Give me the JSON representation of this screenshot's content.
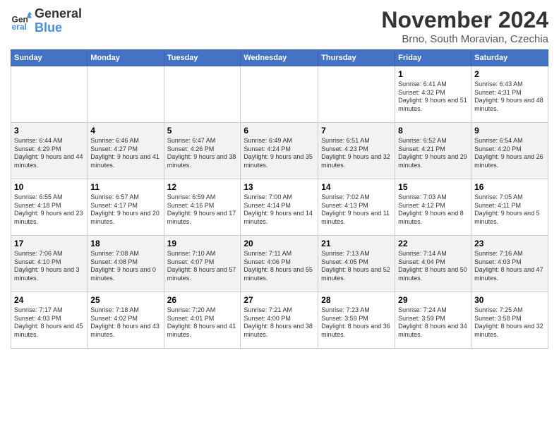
{
  "logo": {
    "line1": "General",
    "line2": "Blue"
  },
  "title": "November 2024",
  "subtitle": "Brno, South Moravian, Czechia",
  "days_of_week": [
    "Sunday",
    "Monday",
    "Tuesday",
    "Wednesday",
    "Thursday",
    "Friday",
    "Saturday"
  ],
  "weeks": [
    [
      {
        "day": "",
        "info": ""
      },
      {
        "day": "",
        "info": ""
      },
      {
        "day": "",
        "info": ""
      },
      {
        "day": "",
        "info": ""
      },
      {
        "day": "",
        "info": ""
      },
      {
        "day": "1",
        "info": "Sunrise: 6:41 AM\nSunset: 4:32 PM\nDaylight: 9 hours and 51 minutes."
      },
      {
        "day": "2",
        "info": "Sunrise: 6:43 AM\nSunset: 4:31 PM\nDaylight: 9 hours and 48 minutes."
      }
    ],
    [
      {
        "day": "3",
        "info": "Sunrise: 6:44 AM\nSunset: 4:29 PM\nDaylight: 9 hours and 44 minutes."
      },
      {
        "day": "4",
        "info": "Sunrise: 6:46 AM\nSunset: 4:27 PM\nDaylight: 9 hours and 41 minutes."
      },
      {
        "day": "5",
        "info": "Sunrise: 6:47 AM\nSunset: 4:26 PM\nDaylight: 9 hours and 38 minutes."
      },
      {
        "day": "6",
        "info": "Sunrise: 6:49 AM\nSunset: 4:24 PM\nDaylight: 9 hours and 35 minutes."
      },
      {
        "day": "7",
        "info": "Sunrise: 6:51 AM\nSunset: 4:23 PM\nDaylight: 9 hours and 32 minutes."
      },
      {
        "day": "8",
        "info": "Sunrise: 6:52 AM\nSunset: 4:21 PM\nDaylight: 9 hours and 29 minutes."
      },
      {
        "day": "9",
        "info": "Sunrise: 6:54 AM\nSunset: 4:20 PM\nDaylight: 9 hours and 26 minutes."
      }
    ],
    [
      {
        "day": "10",
        "info": "Sunrise: 6:55 AM\nSunset: 4:18 PM\nDaylight: 9 hours and 23 minutes."
      },
      {
        "day": "11",
        "info": "Sunrise: 6:57 AM\nSunset: 4:17 PM\nDaylight: 9 hours and 20 minutes."
      },
      {
        "day": "12",
        "info": "Sunrise: 6:59 AM\nSunset: 4:16 PM\nDaylight: 9 hours and 17 minutes."
      },
      {
        "day": "13",
        "info": "Sunrise: 7:00 AM\nSunset: 4:14 PM\nDaylight: 9 hours and 14 minutes."
      },
      {
        "day": "14",
        "info": "Sunrise: 7:02 AM\nSunset: 4:13 PM\nDaylight: 9 hours and 11 minutes."
      },
      {
        "day": "15",
        "info": "Sunrise: 7:03 AM\nSunset: 4:12 PM\nDaylight: 9 hours and 8 minutes."
      },
      {
        "day": "16",
        "info": "Sunrise: 7:05 AM\nSunset: 4:11 PM\nDaylight: 9 hours and 5 minutes."
      }
    ],
    [
      {
        "day": "17",
        "info": "Sunrise: 7:06 AM\nSunset: 4:10 PM\nDaylight: 9 hours and 3 minutes."
      },
      {
        "day": "18",
        "info": "Sunrise: 7:08 AM\nSunset: 4:08 PM\nDaylight: 9 hours and 0 minutes."
      },
      {
        "day": "19",
        "info": "Sunrise: 7:10 AM\nSunset: 4:07 PM\nDaylight: 8 hours and 57 minutes."
      },
      {
        "day": "20",
        "info": "Sunrise: 7:11 AM\nSunset: 4:06 PM\nDaylight: 8 hours and 55 minutes."
      },
      {
        "day": "21",
        "info": "Sunrise: 7:13 AM\nSunset: 4:05 PM\nDaylight: 8 hours and 52 minutes."
      },
      {
        "day": "22",
        "info": "Sunrise: 7:14 AM\nSunset: 4:04 PM\nDaylight: 8 hours and 50 minutes."
      },
      {
        "day": "23",
        "info": "Sunrise: 7:16 AM\nSunset: 4:03 PM\nDaylight: 8 hours and 47 minutes."
      }
    ],
    [
      {
        "day": "24",
        "info": "Sunrise: 7:17 AM\nSunset: 4:03 PM\nDaylight: 8 hours and 45 minutes."
      },
      {
        "day": "25",
        "info": "Sunrise: 7:18 AM\nSunset: 4:02 PM\nDaylight: 8 hours and 43 minutes."
      },
      {
        "day": "26",
        "info": "Sunrise: 7:20 AM\nSunset: 4:01 PM\nDaylight: 8 hours and 41 minutes."
      },
      {
        "day": "27",
        "info": "Sunrise: 7:21 AM\nSunset: 4:00 PM\nDaylight: 8 hours and 38 minutes."
      },
      {
        "day": "28",
        "info": "Sunrise: 7:23 AM\nSunset: 3:59 PM\nDaylight: 8 hours and 36 minutes."
      },
      {
        "day": "29",
        "info": "Sunrise: 7:24 AM\nSunset: 3:59 PM\nDaylight: 8 hours and 34 minutes."
      },
      {
        "day": "30",
        "info": "Sunrise: 7:25 AM\nSunset: 3:58 PM\nDaylight: 8 hours and 32 minutes."
      }
    ]
  ]
}
